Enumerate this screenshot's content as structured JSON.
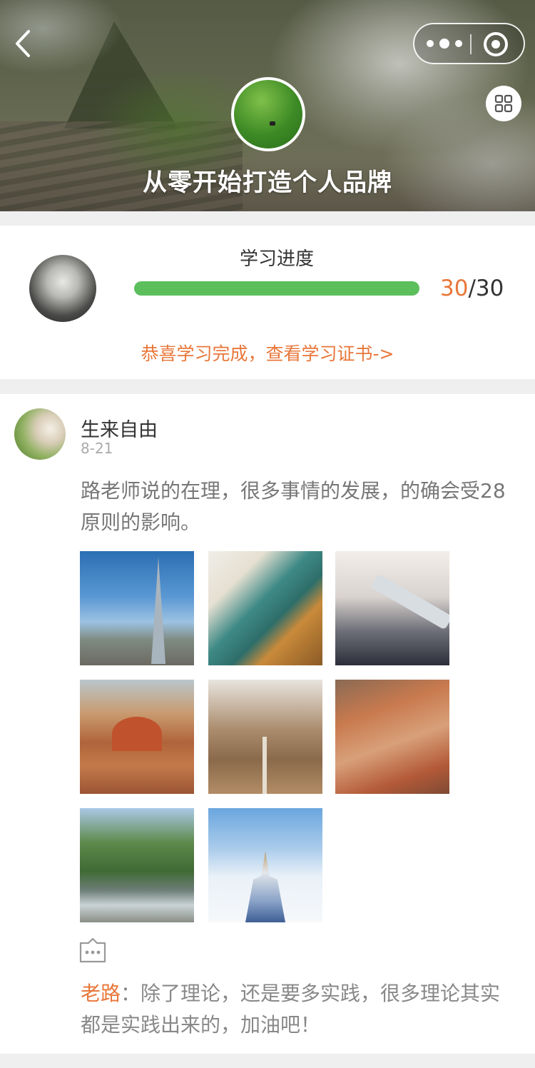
{
  "header": {
    "course_title": "从零开始打造个人品牌"
  },
  "progress": {
    "label": "学习进度",
    "completed": "30",
    "separator": "/",
    "total": "30",
    "fraction": 1.0,
    "certificate_link": "恭喜学习完成，查看学习证书->"
  },
  "post": {
    "author": "生来自由",
    "date": "8-21",
    "text": "路老师说的在理，很多事情的发展，的确会受28原则的影响。",
    "photos": [
      "city-skyline",
      "bridge-aerial",
      "airplane-wing",
      "cathedral-dome",
      "bridge-walkway",
      "rooftops",
      "forest-river",
      "castle"
    ],
    "comment": {
      "author": "老路",
      "separator": "：",
      "text": "除了理论，还是要多实践，很多理论其实都是实践出来的，加油吧！"
    }
  },
  "colors": {
    "accent": "#e8773a",
    "progress_fill": "#5cbf5c",
    "background": "#efefef"
  },
  "icons": {
    "back": "chevron-left-icon",
    "more": "more-dots-icon",
    "close": "target-close-icon",
    "grid": "grid-icon",
    "comment": "comment-bubble-icon"
  }
}
